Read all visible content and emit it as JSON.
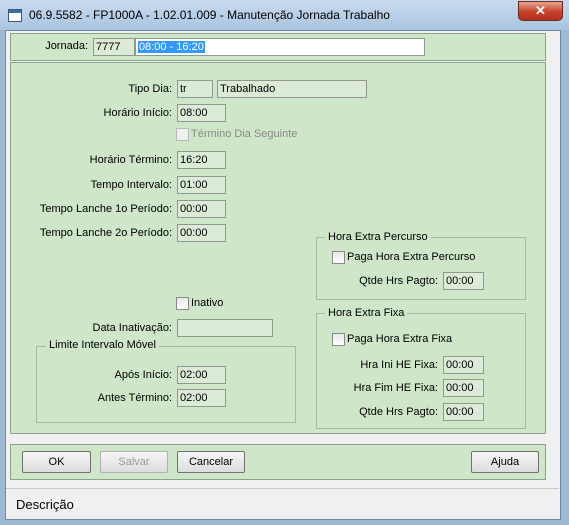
{
  "window": {
    "title": "06.9.5582 - FP1000A - 1.02.01.009 - Manutenção Jornada Trabalho",
    "close_glyph": "✕"
  },
  "header": {
    "jornada_label": "Jornada:",
    "jornada_code": "7777",
    "jornada_desc": "08:00 - 16:20"
  },
  "form": {
    "tipo_dia_label": "Tipo Dia:",
    "tipo_dia_code": "tr",
    "tipo_dia_desc": "Trabalhado",
    "horario_inicio_label": "Horário Início:",
    "horario_inicio": "08:00",
    "termino_seguinte_label": "Término Dia Seguinte",
    "horario_termino_label": "Horário Término:",
    "horario_termino": "16:20",
    "tempo_intervalo_label": "Tempo Intervalo:",
    "tempo_intervalo": "01:00",
    "lanche1_label": "Tempo Lanche 1o Período:",
    "lanche1": "00:00",
    "lanche2_label": "Tempo Lanche 2o Período:",
    "lanche2": "00:00",
    "inativo_label": "Inativo",
    "data_inativacao_label": "Data Inativação:",
    "data_inativacao": ""
  },
  "limite": {
    "title": "Limite Intervalo Móvel",
    "apos_inicio_label": "Após Início:",
    "apos_inicio": "02:00",
    "antes_termino_label": "Antes Término:",
    "antes_termino": "02:00"
  },
  "hora_extra_percurso": {
    "title": "Hora Extra Percurso",
    "paga_label": "Paga Hora Extra Percurso",
    "qtde_label": "Qtde Hrs Pagto:",
    "qtde": "00:00"
  },
  "hora_extra_fixa": {
    "title": "Hora Extra Fixa",
    "paga_label": "Paga Hora Extra Fixa",
    "hra_ini_label": "Hra Ini HE Fixa:",
    "hra_ini": "00:00",
    "hra_fim_label": "Hra Fim HE Fixa:",
    "hra_fim": "00:00",
    "qtde_label": "Qtde Hrs Pagto:",
    "qtde": "00:00"
  },
  "buttons": {
    "ok_label": "OK",
    "salvar_label": "Salvar",
    "cancelar_label": "Cancelar",
    "ajuda_label": "Ajuda"
  },
  "status": {
    "descricao_label": "Descrição"
  },
  "colors": {
    "panel": "#cfe6c8",
    "selection": "#3399ff",
    "close": "#c6402a"
  }
}
